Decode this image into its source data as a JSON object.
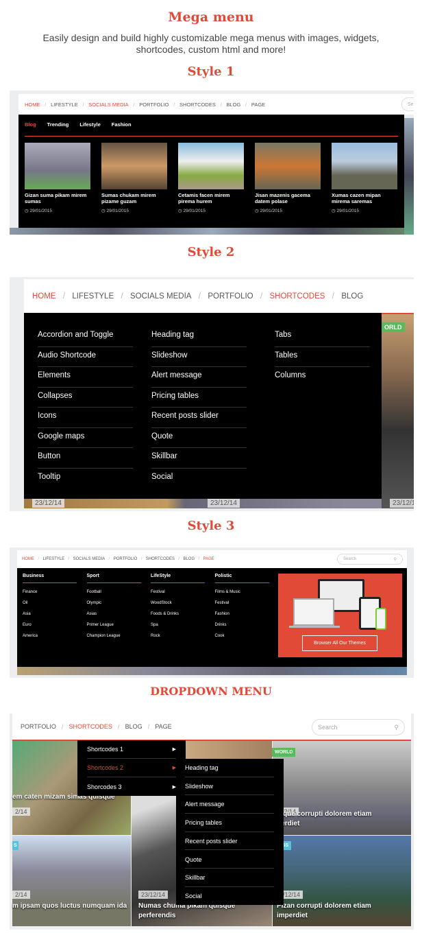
{
  "header": {
    "title": "Mega menu",
    "subtitle": "Easily design and build highly customizable mega menus with images, widgets, shortcodes, custom html and more!"
  },
  "colors": {
    "accent": "#e04a36",
    "world_badge": "#5cb85c",
    "business_badge": "#5bc0de"
  },
  "style1": {
    "heading": "Style 1",
    "nav": [
      {
        "label": "HOME",
        "active": true
      },
      {
        "label": "LIFESTYLE"
      },
      {
        "label": "SOCIALS MEDIA",
        "active": true
      },
      {
        "label": "PORTFOLIO"
      },
      {
        "label": "SHORTCODES"
      },
      {
        "label": "BLOG"
      },
      {
        "label": "PAGE"
      }
    ],
    "search_placeholder": "Se",
    "tabs": [
      {
        "label": "Blog",
        "active": true
      },
      {
        "label": "Trending"
      },
      {
        "label": "Lifestyle"
      },
      {
        "label": "Fashion"
      }
    ],
    "posts": [
      {
        "title": "Gizan suma pikam mirem sumas",
        "date": "29/01/2015"
      },
      {
        "title": "Sumas chukam mirem pizame guzam",
        "date": "29/01/2015"
      },
      {
        "title": "Cetamis facen mirem pirema hurem",
        "date": "29/01/2015"
      },
      {
        "title": "Jisan mazenis gacema datem polase",
        "date": "29/01/2015"
      },
      {
        "title": "Xumas cazen mipan mirema saremas",
        "date": "29/01/2015"
      }
    ]
  },
  "style2": {
    "heading": "Style 2",
    "nav": [
      {
        "label": "HOME",
        "active": true
      },
      {
        "label": "LIFESTYLE"
      },
      {
        "label": "SOCIALS MEDIA"
      },
      {
        "label": "PORTFOLIO"
      },
      {
        "label": "SHORTCODES",
        "active": true
      },
      {
        "label": "BLOG"
      }
    ],
    "columns": [
      [
        "Accordion and Toggle",
        "Audio Shortcode",
        "Elements",
        "Collapses",
        "Icons",
        "Google maps",
        "Button",
        "Tooltip"
      ],
      [
        "Heading tag",
        "Slideshow",
        "Alert message",
        "Pricing tables",
        "Recent posts slider",
        "Quote",
        "Skillbar",
        "Social"
      ],
      [
        "Tabs",
        "Tables",
        "Columns"
      ]
    ],
    "badge": "ORLD",
    "dates": [
      "23/12/14",
      "23/12/14",
      "23/12/14"
    ]
  },
  "style3": {
    "heading": "Style 3",
    "nav": [
      {
        "label": "HOME",
        "active": true
      },
      {
        "label": "LIFESTYLE"
      },
      {
        "label": "SOCIALS MEDIA"
      },
      {
        "label": "PORTFOLIO"
      },
      {
        "label": "SHORTCODES"
      },
      {
        "label": "BLOG"
      },
      {
        "label": "PAGE",
        "active": true
      }
    ],
    "search_placeholder": "Search",
    "columns": [
      {
        "title": "Business",
        "items": [
          "Finance",
          "Oil",
          "Asia",
          "Euro",
          "America"
        ]
      },
      {
        "title": "Sport",
        "items": [
          "Football",
          "Olympic",
          "Asias",
          "Primer League",
          "Champion League"
        ]
      },
      {
        "title": "LifeStyle",
        "items": [
          "Festival",
          "WoodStock",
          "Foods & Drinks",
          "Spa",
          "Rock"
        ]
      },
      {
        "title": "Polistic",
        "items": [
          "Films & Music",
          "Festival",
          "Fashion",
          "Drinks",
          "Cook"
        ]
      }
    ],
    "promo_button": "Browser All Our Themes"
  },
  "dropdown": {
    "heading": "DROPDOWN MENU",
    "nav": [
      {
        "label": "PORTFOLIO"
      },
      {
        "label": "SHORTCODES",
        "active": true
      },
      {
        "label": "BLOG"
      },
      {
        "label": "PAGE"
      }
    ],
    "search_placeholder": "Search",
    "menu": [
      {
        "label": "Shortcodes 1"
      },
      {
        "label": "Shortcodes 2",
        "active": true
      },
      {
        "label": "Shorcodes 3"
      }
    ],
    "submenu": [
      "Heading tag",
      "Slideshow",
      "Alert message",
      "Pricing tables",
      "Recent posts slider",
      "Quote",
      "Skillbar",
      "Social"
    ],
    "badges": {
      "world": "WORLD",
      "business": "NESS",
      "left": "S"
    },
    "cards": [
      {
        "date": "2/14",
        "title": "em caten mizam simas quisque"
      },
      {
        "date": "3/12/14",
        "title": "umque corrupti dolorem etiam nperdiet"
      },
      {
        "date": "2/14",
        "title": "m ipsam quos luctus numquam ida"
      },
      {
        "date": "23/12/14",
        "title": "Numas chuma pikam quisque perferendis"
      },
      {
        "date": "4/12/14",
        "title": "Pizan corrupti dolorem etiam imperdiet"
      }
    ]
  }
}
